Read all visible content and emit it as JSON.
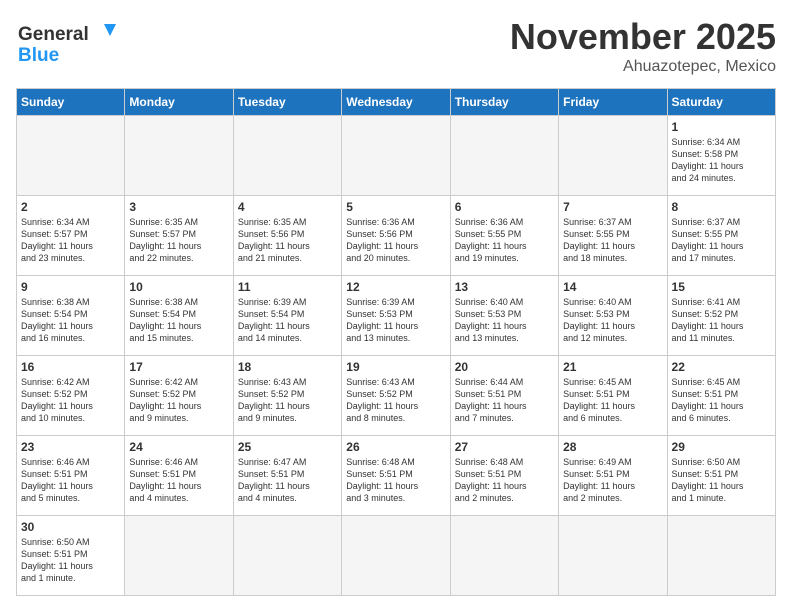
{
  "logo": {
    "line1": "General",
    "line2": "Blue"
  },
  "title": "November 2025",
  "location": "Ahuazotepec, Mexico",
  "days_of_week": [
    "Sunday",
    "Monday",
    "Tuesday",
    "Wednesday",
    "Thursday",
    "Friday",
    "Saturday"
  ],
  "weeks": [
    [
      {
        "day": "",
        "info": ""
      },
      {
        "day": "",
        "info": ""
      },
      {
        "day": "",
        "info": ""
      },
      {
        "day": "",
        "info": ""
      },
      {
        "day": "",
        "info": ""
      },
      {
        "day": "",
        "info": ""
      },
      {
        "day": "1",
        "info": "Sunrise: 6:34 AM\nSunset: 5:58 PM\nDaylight: 11 hours\nand 24 minutes."
      }
    ],
    [
      {
        "day": "2",
        "info": "Sunrise: 6:34 AM\nSunset: 5:57 PM\nDaylight: 11 hours\nand 23 minutes."
      },
      {
        "day": "3",
        "info": "Sunrise: 6:35 AM\nSunset: 5:57 PM\nDaylight: 11 hours\nand 22 minutes."
      },
      {
        "day": "4",
        "info": "Sunrise: 6:35 AM\nSunset: 5:56 PM\nDaylight: 11 hours\nand 21 minutes."
      },
      {
        "day": "5",
        "info": "Sunrise: 6:36 AM\nSunset: 5:56 PM\nDaylight: 11 hours\nand 20 minutes."
      },
      {
        "day": "6",
        "info": "Sunrise: 6:36 AM\nSunset: 5:55 PM\nDaylight: 11 hours\nand 19 minutes."
      },
      {
        "day": "7",
        "info": "Sunrise: 6:37 AM\nSunset: 5:55 PM\nDaylight: 11 hours\nand 18 minutes."
      },
      {
        "day": "8",
        "info": "Sunrise: 6:37 AM\nSunset: 5:55 PM\nDaylight: 11 hours\nand 17 minutes."
      }
    ],
    [
      {
        "day": "9",
        "info": "Sunrise: 6:38 AM\nSunset: 5:54 PM\nDaylight: 11 hours\nand 16 minutes."
      },
      {
        "day": "10",
        "info": "Sunrise: 6:38 AM\nSunset: 5:54 PM\nDaylight: 11 hours\nand 15 minutes."
      },
      {
        "day": "11",
        "info": "Sunrise: 6:39 AM\nSunset: 5:54 PM\nDaylight: 11 hours\nand 14 minutes."
      },
      {
        "day": "12",
        "info": "Sunrise: 6:39 AM\nSunset: 5:53 PM\nDaylight: 11 hours\nand 13 minutes."
      },
      {
        "day": "13",
        "info": "Sunrise: 6:40 AM\nSunset: 5:53 PM\nDaylight: 11 hours\nand 13 minutes."
      },
      {
        "day": "14",
        "info": "Sunrise: 6:40 AM\nSunset: 5:53 PM\nDaylight: 11 hours\nand 12 minutes."
      },
      {
        "day": "15",
        "info": "Sunrise: 6:41 AM\nSunset: 5:52 PM\nDaylight: 11 hours\nand 11 minutes."
      }
    ],
    [
      {
        "day": "16",
        "info": "Sunrise: 6:42 AM\nSunset: 5:52 PM\nDaylight: 11 hours\nand 10 minutes."
      },
      {
        "day": "17",
        "info": "Sunrise: 6:42 AM\nSunset: 5:52 PM\nDaylight: 11 hours\nand 9 minutes."
      },
      {
        "day": "18",
        "info": "Sunrise: 6:43 AM\nSunset: 5:52 PM\nDaylight: 11 hours\nand 9 minutes."
      },
      {
        "day": "19",
        "info": "Sunrise: 6:43 AM\nSunset: 5:52 PM\nDaylight: 11 hours\nand 8 minutes."
      },
      {
        "day": "20",
        "info": "Sunrise: 6:44 AM\nSunset: 5:51 PM\nDaylight: 11 hours\nand 7 minutes."
      },
      {
        "day": "21",
        "info": "Sunrise: 6:45 AM\nSunset: 5:51 PM\nDaylight: 11 hours\nand 6 minutes."
      },
      {
        "day": "22",
        "info": "Sunrise: 6:45 AM\nSunset: 5:51 PM\nDaylight: 11 hours\nand 6 minutes."
      }
    ],
    [
      {
        "day": "23",
        "info": "Sunrise: 6:46 AM\nSunset: 5:51 PM\nDaylight: 11 hours\nand 5 minutes."
      },
      {
        "day": "24",
        "info": "Sunrise: 6:46 AM\nSunset: 5:51 PM\nDaylight: 11 hours\nand 4 minutes."
      },
      {
        "day": "25",
        "info": "Sunrise: 6:47 AM\nSunset: 5:51 PM\nDaylight: 11 hours\nand 4 minutes."
      },
      {
        "day": "26",
        "info": "Sunrise: 6:48 AM\nSunset: 5:51 PM\nDaylight: 11 hours\nand 3 minutes."
      },
      {
        "day": "27",
        "info": "Sunrise: 6:48 AM\nSunset: 5:51 PM\nDaylight: 11 hours\nand 2 minutes."
      },
      {
        "day": "28",
        "info": "Sunrise: 6:49 AM\nSunset: 5:51 PM\nDaylight: 11 hours\nand 2 minutes."
      },
      {
        "day": "29",
        "info": "Sunrise: 6:50 AM\nSunset: 5:51 PM\nDaylight: 11 hours\nand 1 minute."
      }
    ],
    [
      {
        "day": "30",
        "info": "Sunrise: 6:50 AM\nSunset: 5:51 PM\nDaylight: 11 hours\nand 1 minute."
      },
      {
        "day": "",
        "info": ""
      },
      {
        "day": "",
        "info": ""
      },
      {
        "day": "",
        "info": ""
      },
      {
        "day": "",
        "info": ""
      },
      {
        "day": "",
        "info": ""
      },
      {
        "day": "",
        "info": ""
      }
    ]
  ]
}
